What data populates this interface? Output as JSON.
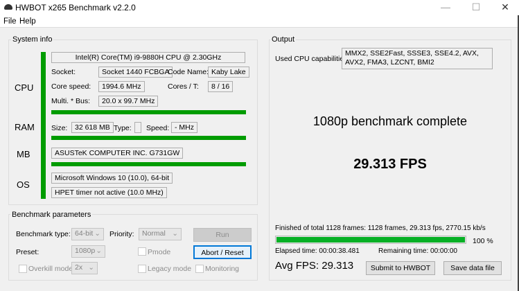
{
  "window": {
    "title": "HWBOT x265 Benchmark v2.2.0",
    "icon": "hwbot-icon",
    "controls": [
      "minimize",
      "maximize",
      "close"
    ]
  },
  "menu": [
    "File",
    "Help"
  ],
  "system_info": {
    "title": "System info",
    "cpu": {
      "label": "CPU",
      "name": "Intel(R) Core(TM) i9-9880H CPU @ 2.30GHz",
      "socket_label": "Socket:",
      "socket": "Socket 1440 FCBGA",
      "codename_label": "Code Name:",
      "codename": "Kaby Lake",
      "speed_label": "Core speed:",
      "speed": "1994.6 MHz",
      "cores_label": "Cores / T:",
      "cores": "8 / 16",
      "multi_label": "Multi. * Bus:",
      "multi": "20.0 x 99.7 MHz"
    },
    "ram": {
      "label": "RAM",
      "size_label": "Size:",
      "size": "32 618 MB",
      "type_label": "Type:",
      "type": "",
      "speed_label": "Speed:",
      "speed": "- MHz"
    },
    "mb": {
      "label": "MB",
      "name": "ASUSTeK COMPUTER INC. G731GW"
    },
    "os": {
      "label": "OS",
      "name": "Microsoft Windows 10 (10.0), 64-bit",
      "timer": "HPET timer not active (10.0 MHz)"
    },
    "accent": "#009c00"
  },
  "params": {
    "title": "Benchmark parameters",
    "type_label": "Benchmark type:",
    "type": "64-bit",
    "priority_label": "Priority:",
    "priority": "Normal",
    "run": "Run",
    "preset_label": "Preset:",
    "preset": "1080p",
    "pmode": "Pmode",
    "abort": "Abort / Reset",
    "overkill": "Overkill mode",
    "overkill_value": "2x",
    "legacy": "Legacy mode",
    "monitoring": "Monitoring"
  },
  "output": {
    "title": "Output",
    "cap_label": "Used CPU capabilities:",
    "caps": "MMX2, SSE2Fast, SSSE3, SSE4.2, AVX, AVX2, FMA3, LZCNT, BMI2",
    "status": "1080p benchmark complete",
    "fps": "29.313 FPS",
    "finished": "Finished of total 1128 frames: 1128 frames, 29.313 fps,  2770.15 kb/s",
    "progress": 100,
    "progress_text": "100 %",
    "elapsed": "Elapsed time: 00:00:38.481",
    "remaining": "Remaining time: 00:00:00",
    "avg": "Avg FPS: 29.313",
    "submit": "Submit to HWBOT",
    "save": "Save data file"
  }
}
